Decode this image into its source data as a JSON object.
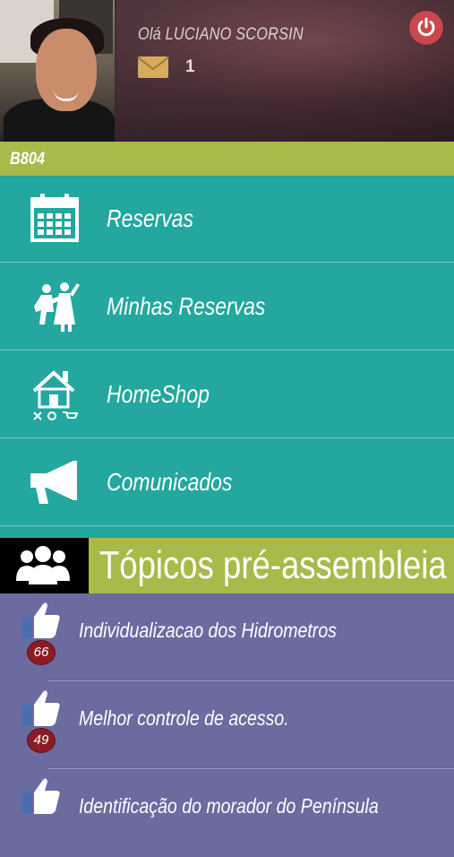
{
  "header": {
    "greeting": "Olá LUCIANO SCORSIN",
    "message_count": "1"
  },
  "unit": "B804",
  "menu": [
    {
      "label": "Reservas"
    },
    {
      "label": "Minhas Reservas"
    },
    {
      "label": "HomeShop"
    },
    {
      "label": "Comunicados"
    }
  ],
  "topics": {
    "title": "Tópicos pré-assembleia",
    "items": [
      {
        "text": "Individualizacao dos Hidrometros",
        "likes": "66"
      },
      {
        "text": "Melhor controle de acesso.",
        "likes": "49"
      },
      {
        "text": "Identificação do morador do Península",
        "likes": ""
      }
    ]
  },
  "colors": {
    "menu_bg": "#23a79e",
    "accent_green": "#a9b94a",
    "topics_bg": "#6c6b9f",
    "power": "#c9474d",
    "badge": "#8b1c24"
  }
}
